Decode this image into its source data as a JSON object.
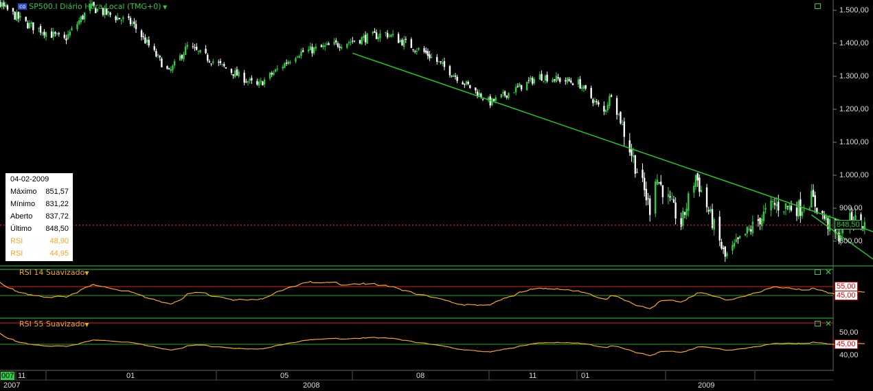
{
  "title": "SP500.I Diário Hora Local (TMG+0)",
  "title_badge": "co",
  "info_box": {
    "date": "04-02-2009",
    "rows": [
      {
        "label": "Máximo",
        "value": "851,57"
      },
      {
        "label": "Mínimo",
        "value": "831,22"
      },
      {
        "label": "Aberto",
        "value": "837,72"
      },
      {
        "label": "Último",
        "value": "848,50"
      },
      {
        "label": "RSI",
        "value": "48,90"
      },
      {
        "label": "RSI",
        "value": "44,95"
      }
    ]
  },
  "panels": {
    "rsi14_label": "RSI 14 Suavizado",
    "rsi55_label": "RSI 55 Suavizado"
  },
  "price_axis": {
    "ticks": [
      "1.500,00",
      "1.400,00",
      "1.300,00",
      "1.200,00",
      "1.100,00",
      "1.000,00",
      "900,00",
      "800,00"
    ],
    "last_value": "848,50"
  },
  "rsi14_axis": {
    "upper": "55,00",
    "lower": "45,00"
  },
  "rsi55_axis": {
    "ticks": [
      "50,00",
      "40,00"
    ],
    "level": "45,00"
  },
  "time_axis": {
    "months": [
      "007",
      "11",
      "01",
      "05",
      "08",
      "11",
      "01"
    ],
    "years": [
      "2007",
      "2008",
      "2009"
    ]
  },
  "colors": {
    "background": "#000000",
    "up_candle": "#2ecc40",
    "down_candle": "#ffffff",
    "trendline": "#22cc22",
    "rsi_line": "#f5a623",
    "last_price_line": "#e02020",
    "upper_level": "#e02020",
    "lower_level": "#22aa22"
  },
  "chart_data": {
    "type": "candlestick",
    "title": "SP500.I Diário Hora Local (TMG+0)",
    "y_range": [
      730,
      1540
    ],
    "x_range": [
      "2007-10",
      "2009-05"
    ],
    "approx_close_path": [
      {
        "date": "2007-10-01",
        "close": 1510
      },
      {
        "date": "2007-10-11",
        "close": 1560
      },
      {
        "date": "2007-11-05",
        "close": 1460
      },
      {
        "date": "2007-11-26",
        "close": 1410
      },
      {
        "date": "2007-12-10",
        "close": 1510
      },
      {
        "date": "2008-01-02",
        "close": 1460
      },
      {
        "date": "2008-01-22",
        "close": 1310
      },
      {
        "date": "2008-02-01",
        "close": 1390
      },
      {
        "date": "2008-03-10",
        "close": 1270
      },
      {
        "date": "2008-04-01",
        "close": 1370
      },
      {
        "date": "2008-05-19",
        "close": 1430
      },
      {
        "date": "2008-06-10",
        "close": 1370
      },
      {
        "date": "2008-07-15",
        "close": 1220
      },
      {
        "date": "2008-08-11",
        "close": 1300
      },
      {
        "date": "2008-09-01",
        "close": 1280
      },
      {
        "date": "2008-09-15",
        "close": 1190
      },
      {
        "date": "2008-09-19",
        "close": 1250
      },
      {
        "date": "2008-10-10",
        "close": 900
      },
      {
        "date": "2008-10-13",
        "close": 1000
      },
      {
        "date": "2008-10-27",
        "close": 850
      },
      {
        "date": "2008-11-04",
        "close": 1000
      },
      {
        "date": "2008-11-20",
        "close": 750
      },
      {
        "date": "2008-12-01",
        "close": 820
      },
      {
        "date": "2008-12-16",
        "close": 910
      },
      {
        "date": "2008-12-31",
        "close": 900
      },
      {
        "date": "2009-01-06",
        "close": 930
      },
      {
        "date": "2009-01-20",
        "close": 810
      },
      {
        "date": "2009-01-28",
        "close": 870
      },
      {
        "date": "2009-02-04",
        "close": 848.5
      }
    ],
    "last_bar": {
      "date": "04-02-2009",
      "high": 851.57,
      "low": 831.22,
      "open": 837.72,
      "close": 848.5
    },
    "trendlines": [
      {
        "from": {
          "date": "2008-05-01",
          "value": 1370
        },
        "to": {
          "date": "2009-03-01",
          "value": 790
        }
      },
      {
        "from": {
          "date": "2009-01-06",
          "value": 880
        },
        "to": {
          "date": "2009-02-10",
          "value": 740
        }
      }
    ],
    "indicators": [
      {
        "name": "RSI 14 Suavizado",
        "last": 48.9,
        "levels": [
          55,
          45
        ]
      },
      {
        "name": "RSI 55 Suavizado",
        "last": 44.95,
        "levels": [
          45
        ]
      }
    ]
  }
}
